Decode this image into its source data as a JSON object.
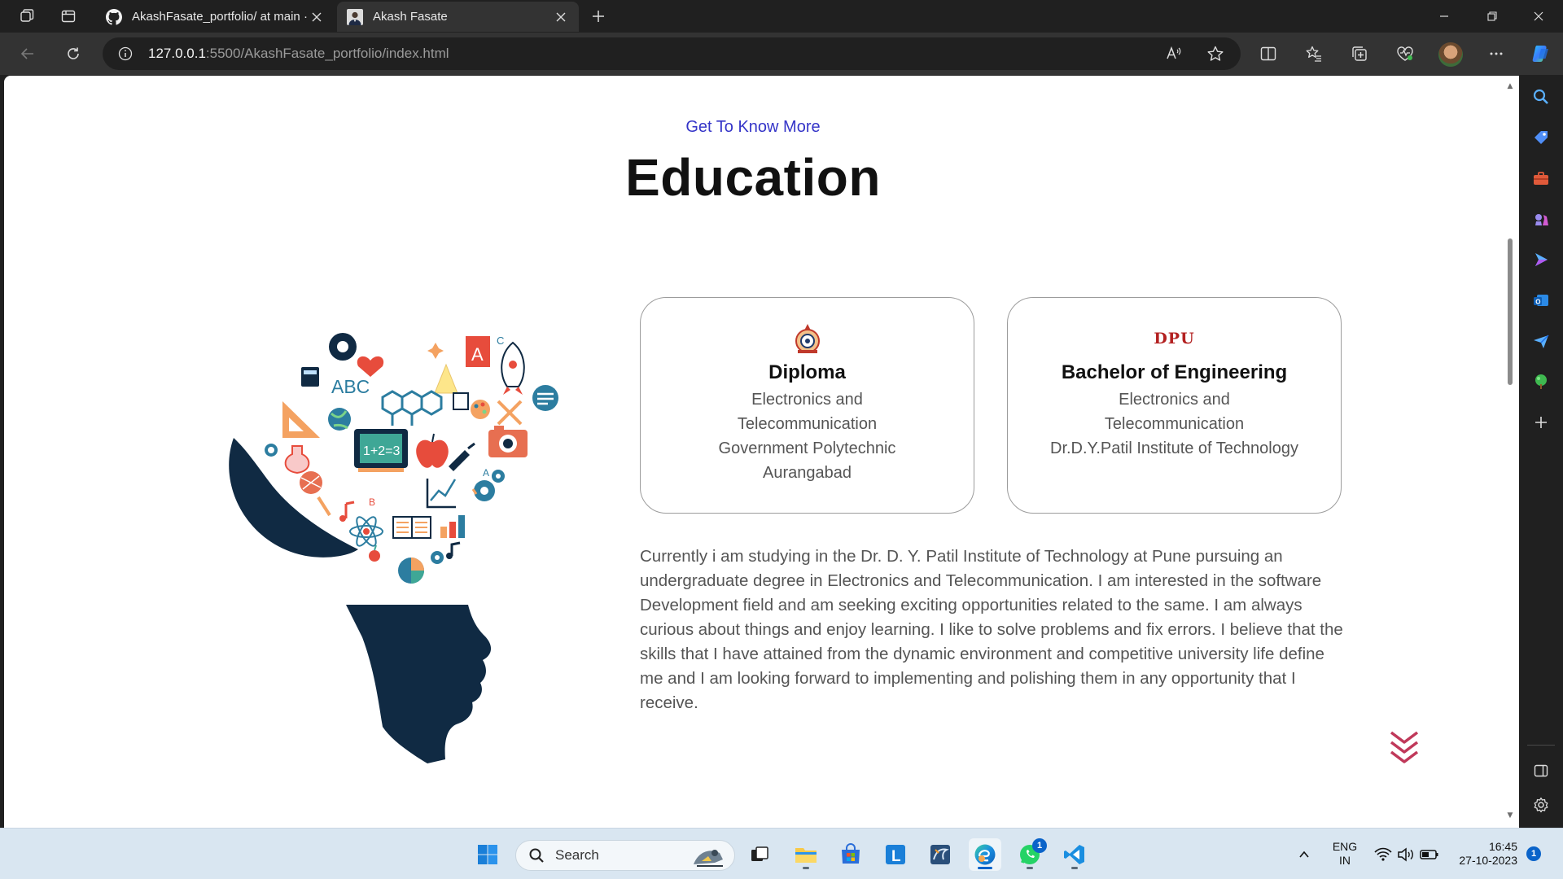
{
  "browser": {
    "tabs": [
      {
        "title": "AkashFasate_portfolio/ at main ·",
        "icon": "github-icon"
      },
      {
        "title": "Akash Fasate",
        "icon": "profile-photo-icon"
      }
    ],
    "url": {
      "host": "127.0.0.1",
      "path": ":5500/AkashFasate_portfolio/index.html"
    }
  },
  "page": {
    "subtitle": "Get To Know More",
    "heading": "Education",
    "cards": [
      {
        "logo": "polytechnic-emblem",
        "title": "Diploma",
        "lines": [
          "Electronics and",
          "Telecommunication",
          "Government Polytechnic",
          "Aurangabad"
        ]
      },
      {
        "logo_text": "DPU",
        "title": "Bachelor of Engineering",
        "lines": [
          "Electronics and",
          "Telecommunication",
          "Dr.D.Y.Patil Institute of Technology"
        ]
      }
    ],
    "about": "Currently i am studying in the Dr. D. Y. Patil Institute of Technology at Pune pursuing an undergraduate degree in Electronics and Telecommunication. I am interested in the software Development field and am seeking exciting opportunities related to the same. I am always curious about things and enjoy learning. I like to solve problems and fix errors. I believe that the skills that I have attained from the dynamic environment and competitive university life define me and I am looking forward to implementing and polishing them in any opportunity that I receive.",
    "accent_color": "#3535c8",
    "scroll_arrow_color": "#c0395a"
  },
  "taskbar": {
    "search_label": "Search",
    "lang": "ENG",
    "region": "IN",
    "time": "16:45",
    "date": "27-10-2023",
    "whatsapp_badge": "1",
    "notification_badge": "1"
  }
}
